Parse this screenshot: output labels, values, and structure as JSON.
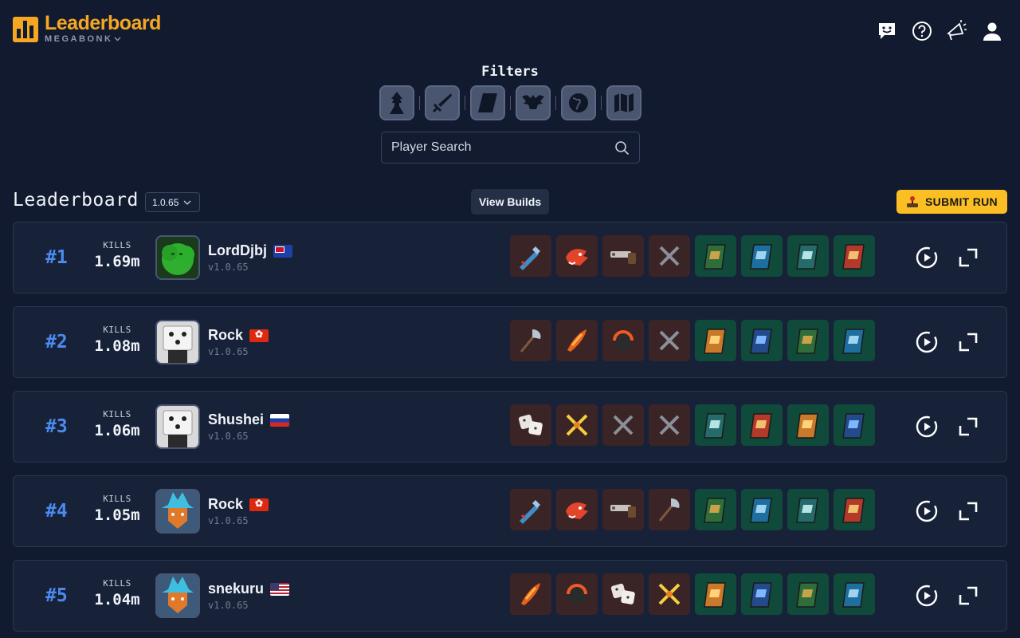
{
  "header": {
    "title": "Leaderboard",
    "subtitle": "MEGABONK",
    "icons": [
      "chat-smile-icon",
      "help-icon",
      "announcement-icon",
      "user-icon"
    ]
  },
  "filters": {
    "title": "Filters",
    "buttons": [
      "character-filter-icon",
      "weapon-filter-icon",
      "tome-filter-icon",
      "item-filter-icon",
      "world-filter-icon",
      "map-filter-icon"
    ],
    "search_placeholder": "Player Search"
  },
  "leaderboard": {
    "title": "Leaderboard",
    "version": "1.0.65",
    "view_builds_label": "View Builds",
    "submit_label": "SUBMIT RUN",
    "kills_label": "KILLS",
    "rows": [
      {
        "rank": "#1",
        "kills": "1.69m",
        "name": "LordDjbj",
        "version": "v1.0.65",
        "flag": "nz",
        "avatar": "green-bush",
        "items": [
          "weapon",
          "weapon",
          "weapon",
          "empty",
          "tome",
          "tome",
          "tome",
          "tome"
        ]
      },
      {
        "rank": "#2",
        "kills": "1.08m",
        "name": "Rock",
        "version": "v1.0.65",
        "flag": "hk",
        "avatar": "dice",
        "items": [
          "weapon",
          "weapon",
          "weapon",
          "empty",
          "tome",
          "tome",
          "tome",
          "tome"
        ]
      },
      {
        "rank": "#3",
        "kills": "1.06m",
        "name": "Shushei",
        "version": "v1.0.65",
        "flag": "ru",
        "avatar": "dice",
        "items": [
          "weapon",
          "weapon",
          "empty",
          "empty",
          "tome",
          "tome",
          "tome",
          "tome"
        ]
      },
      {
        "rank": "#4",
        "kills": "1.05m",
        "name": "Rock",
        "version": "v1.0.65",
        "flag": "hk",
        "avatar": "wizard-fox",
        "items": [
          "weapon",
          "weapon",
          "weapon",
          "weapon",
          "tome",
          "tome",
          "tome",
          "tome"
        ]
      },
      {
        "rank": "#5",
        "kills": "1.04m",
        "name": "snekuru",
        "version": "v1.0.65",
        "flag": "us",
        "avatar": "wizard-fox",
        "items": [
          "weapon",
          "weapon",
          "weapon",
          "weapon",
          "tome",
          "tome",
          "tome",
          "tome"
        ]
      }
    ]
  },
  "colors": {
    "background": "#111a2e",
    "accent": "#f5a623",
    "rank": "#4b8bf0",
    "submit": "#fbbf24",
    "weapon_slot": "#3b2426",
    "tome_slot": "#0f4a3a"
  }
}
